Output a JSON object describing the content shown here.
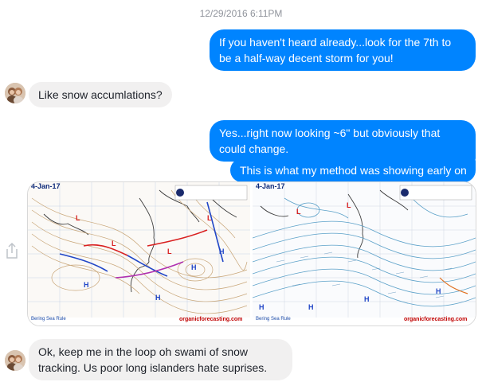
{
  "header": {
    "timestamp": "12/29/2016 6:11PM"
  },
  "messages": [
    {
      "sender": "me",
      "text": "If you haven't heard already...look for the 7th to be a half-way decent storm for you!"
    },
    {
      "sender": "friend",
      "text": "Like snow accumlations?"
    },
    {
      "sender": "me",
      "text": "Yes...right now looking ~6\" but obviously that could change."
    },
    {
      "sender": "me",
      "text": "This is what my method was showing early on"
    },
    {
      "sender": "friend",
      "text": "Ok, keep me in the loop oh swami of snow tracking. Us poor long islanders hate suprises."
    }
  ],
  "attachment": {
    "left_map": {
      "date_label": "4-Jan-17",
      "footer_left": "Bering Sea Rule",
      "footer_right": "organicforecasting.com"
    },
    "right_map": {
      "date_label": "4-Jan-17",
      "footer_left": "Bering Sea Rule",
      "footer_right": "organicforecasting.com"
    }
  },
  "icons": {
    "share": "share-icon",
    "avatar": "avatar"
  },
  "colors": {
    "outgoing": "#0084ff",
    "incoming": "#f1f0f0",
    "timestamp": "#90949c"
  }
}
